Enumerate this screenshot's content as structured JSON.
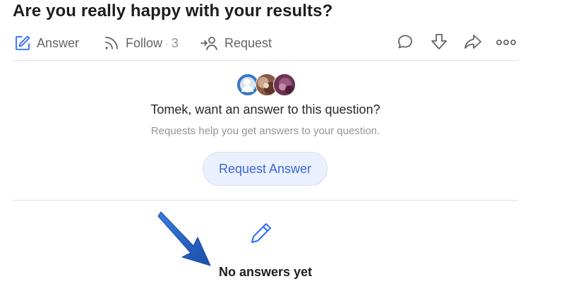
{
  "question": {
    "title": "Are you really happy with your results?"
  },
  "actions": {
    "answer_label": "Answer",
    "follow_label": "Follow",
    "follow_dot": "·",
    "follow_count": "3",
    "request_label": "Request"
  },
  "icons": {
    "answer": "pencil-square-icon",
    "follow": "rss-icon",
    "request": "person-arrow-icon",
    "comment": "comment-icon",
    "downvote": "downvote-arrow-icon",
    "share": "share-arrow-icon",
    "more": "more-dots-icon"
  },
  "request_prompt": {
    "title": "Tomek, want an answer to this question?",
    "subtitle": "Requests help you get answers to your question.",
    "button_label": "Request Answer"
  },
  "empty_state": {
    "label": "No answers yet"
  },
  "colors": {
    "accent": "#2e69ff",
    "icon_gray": "#636466",
    "annotation_arrow": "#1f5fc4"
  }
}
